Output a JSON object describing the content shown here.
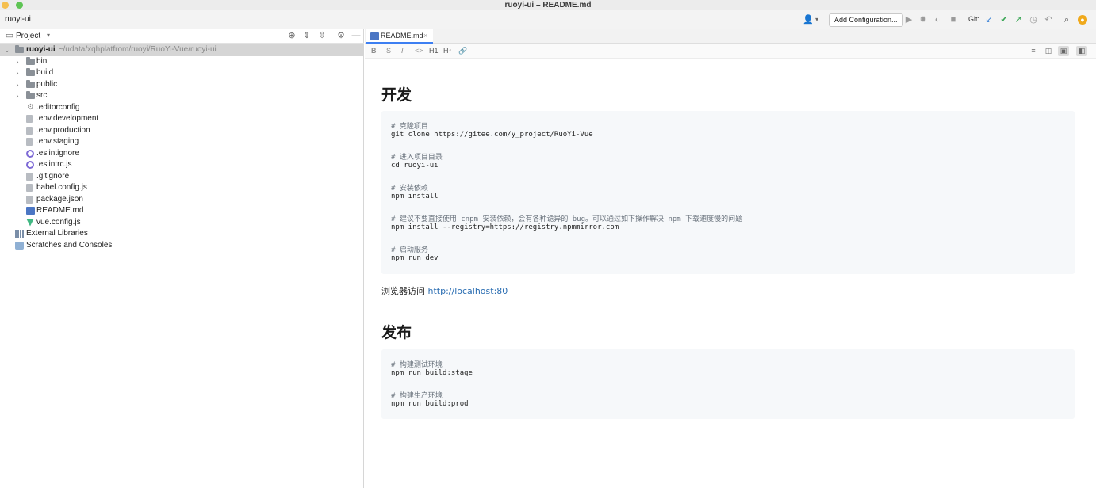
{
  "window": {
    "title": "ruoyi-ui – README.md"
  },
  "navbar": {
    "breadcrumb": "ruoyi-ui",
    "add_config_label": "Add Configuration...",
    "git_label": "Git:"
  },
  "project": {
    "title": "Project",
    "root": {
      "name": "ruoyi-ui",
      "path": "~/udata/xqhplatfrom/ruoyi/RuoYi-Vue/ruoyi-ui"
    },
    "items": [
      {
        "label": "bin",
        "kind": "folder"
      },
      {
        "label": "build",
        "kind": "folder"
      },
      {
        "label": "public",
        "kind": "folder"
      },
      {
        "label": "src",
        "kind": "folder"
      },
      {
        "label": ".editorconfig",
        "kind": "config"
      },
      {
        "label": ".env.development",
        "kind": "file"
      },
      {
        "label": ".env.production",
        "kind": "file"
      },
      {
        "label": ".env.staging",
        "kind": "file"
      },
      {
        "label": ".eslintignore",
        "kind": "eslint"
      },
      {
        "label": ".eslintrc.js",
        "kind": "eslint"
      },
      {
        "label": ".gitignore",
        "kind": "file"
      },
      {
        "label": "babel.config.js",
        "kind": "file"
      },
      {
        "label": "package.json",
        "kind": "file"
      },
      {
        "label": "README.md",
        "kind": "markdown"
      },
      {
        "label": "vue.config.js",
        "kind": "vue"
      }
    ],
    "external_libraries": "External Libraries",
    "scratches": "Scratches and Consoles"
  },
  "editor": {
    "tab_label": "README.md",
    "tab_close": "×",
    "toolbar": {
      "bold": "B",
      "strike": "S",
      "italic": "I",
      "code": "<>",
      "h1": "H1",
      "h2": "H↑"
    }
  },
  "doc": {
    "h_develop": "开发",
    "dev_code": [
      {
        "text": "# 克隆项目",
        "comment": true
      },
      {
        "text": "git clone https://gitee.com/y_project/RuoYi-Vue",
        "comment": false
      },
      {
        "text": "# 进入项目目录",
        "comment": true
      },
      {
        "text": "cd ruoyi-ui",
        "comment": false
      },
      {
        "text": "# 安装依赖",
        "comment": true
      },
      {
        "text": "npm install",
        "comment": false
      },
      {
        "text": "# 建议不要直接使用 cnpm 安装依赖，会有各种诡异的 bug。可以通过如下操作解决 npm 下载速度慢的问题",
        "comment": true
      },
      {
        "text": "npm install --registry=https://registry.npmmirror.com",
        "comment": false
      },
      {
        "text": "# 启动服务",
        "comment": true
      },
      {
        "text": "npm run dev",
        "comment": false
      }
    ],
    "visit_text": "浏览器访问 ",
    "visit_link": "http://localhost:80",
    "h_release": "发布",
    "release_code": [
      {
        "text": "# 构建测试环境",
        "comment": true
      },
      {
        "text": "npm run build:stage",
        "comment": false
      },
      {
        "text": "# 构建生产环境",
        "comment": true
      },
      {
        "text": "npm run build:prod",
        "comment": false
      }
    ]
  }
}
